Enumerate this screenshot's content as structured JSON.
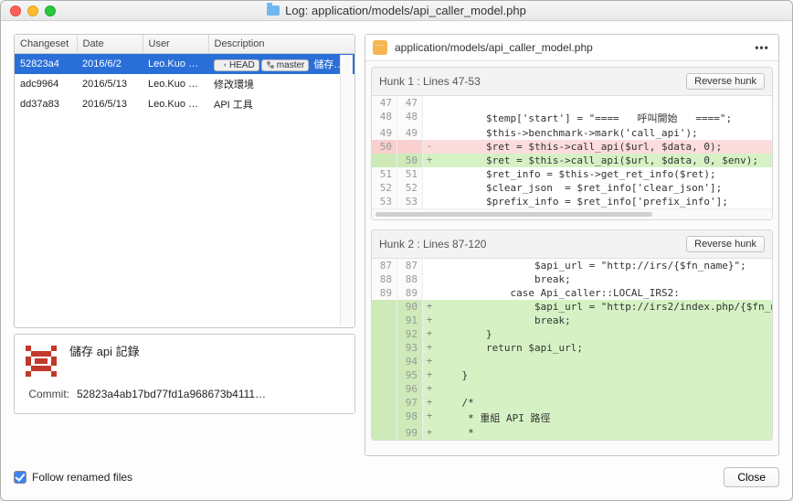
{
  "window": {
    "title": "Log: application/models/api_caller_model.php"
  },
  "columns": {
    "changeset": "Changeset",
    "date": "Date",
    "user": "User",
    "description": "Description"
  },
  "badges": {
    "head": "HEAD",
    "master": "master"
  },
  "commits": [
    {
      "hash": "52823a4",
      "date": "2016/6/2",
      "user": "Leo.Kuo <…",
      "desc": "儲存…",
      "selected": true,
      "badges": true
    },
    {
      "hash": "adc9964",
      "date": "2016/5/13",
      "user": "Leo.Kuo <…",
      "desc": "修改環境",
      "selected": false
    },
    {
      "hash": "dd37a83",
      "date": "2016/5/13",
      "user": "Leo.Kuo <…",
      "desc": "API 工具",
      "selected": false
    }
  ],
  "detail": {
    "message": "儲存 api 記錄",
    "commit_label": "Commit:",
    "commit_hash": "52823a4ab17bd77fd1a968673b4111…"
  },
  "diff": {
    "filepath": "application/models/api_caller_model.php",
    "more": "•••",
    "reverse_label": "Reverse hunk",
    "hunks": [
      {
        "title": "Hunk 1 : Lines 47-53",
        "lines": [
          {
            "a": "47",
            "b": "47",
            "t": " ",
            "c": ""
          },
          {
            "a": "48",
            "b": "48",
            "t": " ",
            "c": "        $temp['start'] = \"====   呼叫開始   ====\";"
          },
          {
            "a": "49",
            "b": "49",
            "t": " ",
            "c": "        $this->benchmark->mark('call_api');"
          },
          {
            "a": "50",
            "b": "",
            "t": "-",
            "c": "        $ret = $this->call_api($url, $data, 0);"
          },
          {
            "a": "",
            "b": "50",
            "t": "+",
            "c": "        $ret = $this->call_api($url, $data, 0, $env);"
          },
          {
            "a": "51",
            "b": "51",
            "t": " ",
            "c": "        $ret_info = $this->get_ret_info($ret);"
          },
          {
            "a": "52",
            "b": "52",
            "t": " ",
            "c": "        $clear_json  = $ret_info['clear_json'];"
          },
          {
            "a": "53",
            "b": "53",
            "t": " ",
            "c": "        $prefix_info = $ret_info['prefix_info'];"
          }
        ],
        "scrollbar": true
      },
      {
        "title": "Hunk 2 : Lines 87-120",
        "lines": [
          {
            "a": "87",
            "b": "87",
            "t": " ",
            "c": "                $api_url = \"http://irs/{$fn_name}\";"
          },
          {
            "a": "88",
            "b": "88",
            "t": " ",
            "c": "                break;"
          },
          {
            "a": "89",
            "b": "89",
            "t": " ",
            "c": "            case Api_caller::LOCAL_IRS2:"
          },
          {
            "a": "",
            "b": "90",
            "t": "+",
            "c": "                $api_url = \"http://irs2/index.php/{$fn_n"
          },
          {
            "a": "",
            "b": "91",
            "t": "+",
            "c": "                break;"
          },
          {
            "a": "",
            "b": "92",
            "t": "+",
            "c": "        }"
          },
          {
            "a": "",
            "b": "93",
            "t": "+",
            "c": "        return $api_url;"
          },
          {
            "a": "",
            "b": "94",
            "t": "+",
            "c": ""
          },
          {
            "a": "",
            "b": "95",
            "t": "+",
            "c": "    }"
          },
          {
            "a": "",
            "b": "96",
            "t": "+",
            "c": ""
          },
          {
            "a": "",
            "b": "97",
            "t": "+",
            "c": "    /*"
          },
          {
            "a": "",
            "b": "98",
            "t": "+",
            "c": "     * 重組 API 路徑"
          },
          {
            "a": "",
            "b": "99",
            "t": "+",
            "c": "     *"
          }
        ]
      }
    ]
  },
  "footer": {
    "follow": "Follow renamed files",
    "close": "Close"
  }
}
